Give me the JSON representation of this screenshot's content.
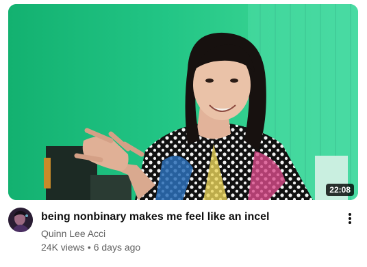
{
  "video": {
    "title": "being nonbinary makes me feel like an incel",
    "duration": "22:08",
    "channel": "Quinn Lee Acci",
    "views": "24K views",
    "separator": "•",
    "age": "6 days ago"
  },
  "icons": {
    "more": "more-vert-icon",
    "avatar": "channel-avatar"
  },
  "colors": {
    "thumbnail_background": "#21c483",
    "secondary_text": "#606060",
    "primary_text": "#0f0f0f"
  }
}
